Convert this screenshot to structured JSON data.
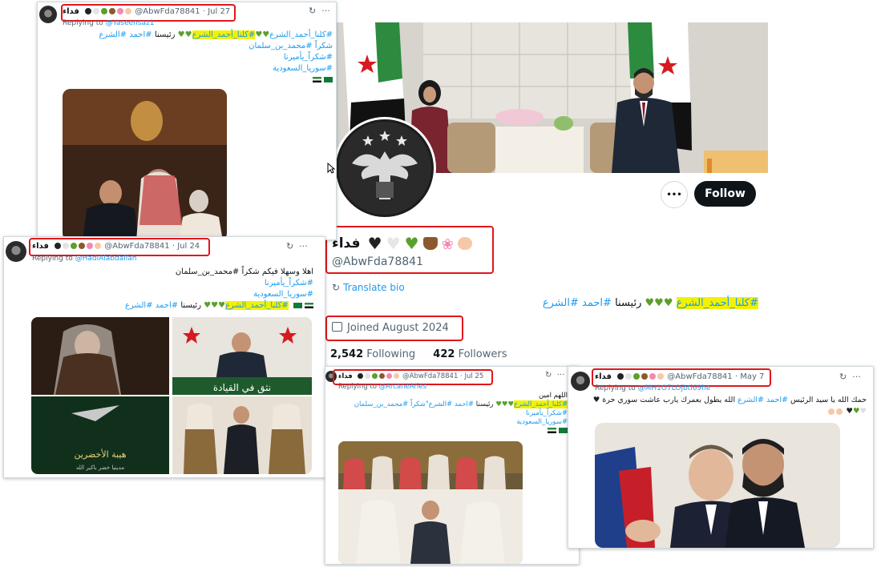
{
  "profile": {
    "display_name": "فداء",
    "handle": "@AbwFda78841",
    "follow_label": "Follow",
    "more_label": "•••",
    "translate_label": "Translate bio",
    "bio_hashtag_highlight": "#كلنا_أحمد_الشرع",
    "bio_text": "رئيسنا",
    "bio_hashtag2": "#احمد",
    "bio_hashtag3": "#الشرع",
    "joined": "Joined August 2024",
    "following_count": "2,542",
    "following_label": "Following",
    "followers_count": "422",
    "followers_label": "Followers"
  },
  "tweets": [
    {
      "name": "فداء",
      "handle": "@AbwFda78841",
      "date": "Jul 27",
      "replying_prefix": "Replying to",
      "replying_to": "@Yaseensaz1",
      "line1_highlight": "#كلنا_أحمد_الشرع",
      "line1_tags": "#كلنا_أحمد_الشرع",
      "line2_text": "رئيسنا",
      "line2_tags": "#احمد #الشرع",
      "line3": "شكراً #محمد_بن_سلمان",
      "line4": "#شكراً_يأميرنا",
      "line5": "#سوريا_السعودية"
    },
    {
      "name": "فداء",
      "handle": "@AbwFda78841",
      "date": "Jul 24",
      "replying_prefix": "Replying to",
      "replying_to": "@HadiAlabdallah",
      "line1": "اهلا وسهلا فيكم شكراً #محمد_بن_سلمان",
      "line2": "#شكراً_يأميرنا",
      "line3": "#سوريا_السعودية",
      "line4_highlight": "#كلنا_أحمد_الشرع",
      "line4_text": "رئيسنا",
      "line4_tags": "#احمد #الشرع",
      "img_caption_top": "نثق في القيادة",
      "img_caption_bottom": "هيبة الأخضرين",
      "img_caption_small": "مدينيا خضر باكير الله"
    },
    {
      "name": "فداء",
      "handle": "@AbwFda78841",
      "date": "Jul 25",
      "replying_prefix": "Replying to",
      "replying_to": "@ArcaneAries",
      "line1": "اللهم امين",
      "line2_highlight": "#كلنا_أحمد_الشرع",
      "line2_text": "رئيسنا",
      "line2_tags": "#احمد #الشرع",
      "line2_tail": "\"شكراً #محمد_بن_سلمان",
      "line3": "#شكراً_يأميرنا",
      "line4": "#سوريا_السعودية"
    },
    {
      "name": "فداء",
      "handle": "@AbwFda78841",
      "date": "May 7",
      "replying_prefix": "Replying to",
      "replying_to": "@MH1O7LOjbtl69he",
      "line1_pre": "حمك الله يا سيد الرئيس",
      "line1_tags": "#احمد #الشرع",
      "line1_post": "الله يطول بعمرك يارب عاشت سوري حرة"
    }
  ],
  "colors": {
    "accent": "#1d9bf0",
    "highlight": "#f2f200",
    "annotation": "#e0161b",
    "green_heart": "#5aa02c"
  }
}
